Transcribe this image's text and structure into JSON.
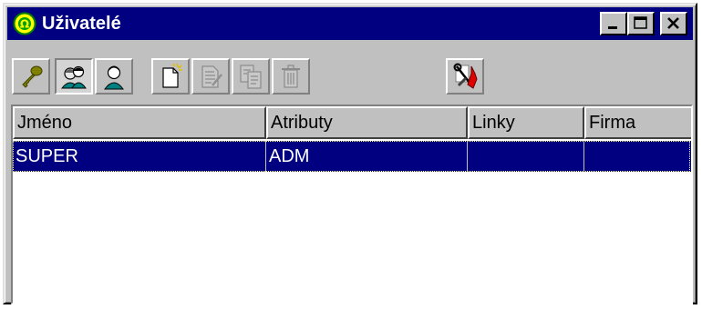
{
  "window": {
    "title": "Uživatelé",
    "controls": {
      "minimize": "minimize",
      "maximize": "maximize",
      "close": "close"
    }
  },
  "toolbar": {
    "buttons": [
      {
        "id": "key",
        "icon": "key-icon",
        "enabled": true,
        "pressed": false
      },
      {
        "id": "users-group",
        "icon": "user-group-icon",
        "enabled": true,
        "pressed": true
      },
      {
        "id": "user",
        "icon": "user-icon",
        "enabled": true,
        "pressed": false
      },
      {
        "id": "new",
        "icon": "new-document-icon",
        "enabled": true,
        "pressed": false
      },
      {
        "id": "edit",
        "icon": "edit-document-icon",
        "enabled": false,
        "pressed": false
      },
      {
        "id": "copy",
        "icon": "copy-document-icon",
        "enabled": false,
        "pressed": false
      },
      {
        "id": "delete",
        "icon": "trash-icon",
        "enabled": false,
        "pressed": false
      },
      {
        "id": "settings",
        "icon": "tools-icon",
        "enabled": true,
        "pressed": false
      }
    ]
  },
  "table": {
    "columns": [
      "Jméno",
      "Atributy",
      "Linky",
      "Firma"
    ],
    "rows": [
      {
        "cells": [
          "SUPER",
          "ADM",
          "",
          ""
        ],
        "selected": true
      }
    ]
  },
  "colors": {
    "title_bar": "#000080",
    "selection": "#000080",
    "face": "#c0c0c0"
  }
}
